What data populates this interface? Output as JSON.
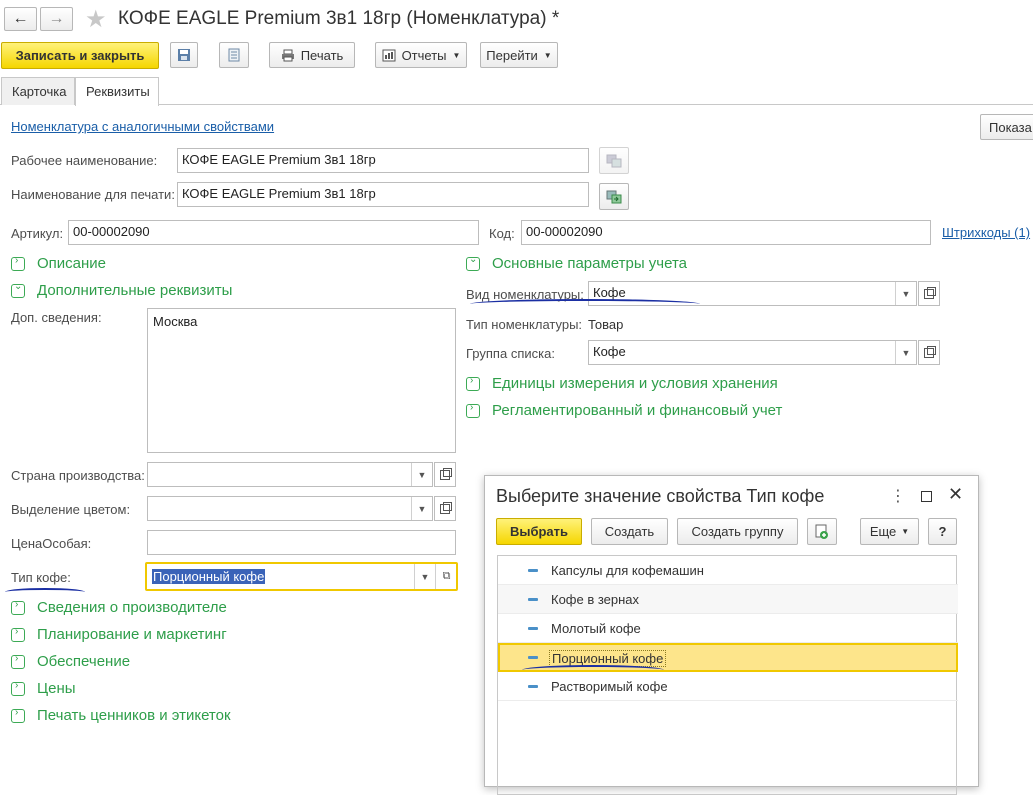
{
  "window": {
    "back_label": "←",
    "forward_label": "→",
    "title": "КОФЕ EAGLE Premium 3в1 18гр (Номенклатура) *"
  },
  "toolbar": {
    "save_close": "Записать и закрыть",
    "print": "Печать",
    "reports": "Отчеты",
    "goto": "Перейти"
  },
  "tabs": [
    "Карточка",
    "Реквизиты"
  ],
  "form": {
    "similar_link": "Номенклатура с аналогичными свойствами",
    "show_button": "Показа",
    "work_name_label": "Рабочее наименование:",
    "work_name_value": "КОФЕ EAGLE Premium 3в1 18гр",
    "print_name_label": "Наименование для печати:",
    "print_name_value": "КОФЕ EAGLE Premium 3в1 18гр",
    "article_label": "Артикул:",
    "article_value": "00-00002090",
    "code_label": "Код:",
    "code_value": "00-00002090",
    "barcodes_link": "Штрихкоды (1)",
    "dop_info_label": "Доп. сведения:",
    "dop_info_value": "Москва",
    "country_label": "Страна производства:",
    "color_label": "Выделение цветом:",
    "price_label": "ЦенаОсобая:",
    "coffee_type_label": "Тип кофе:",
    "coffee_type_value": "Порционный кофе"
  },
  "groups_left": {
    "description": "Описание",
    "additional": "Дополнительные реквизиты",
    "manufacturer": "Сведения о производителе",
    "planning": "Планирование и маркетинг",
    "supply": "Обеспечение",
    "prices": "Цены",
    "labels": "Печать ценников и этикеток"
  },
  "groups_right": {
    "main_params": "Основные параметры учета",
    "units": "Единицы измерения и условия хранения",
    "regulated": "Регламентированный и финансовый учет"
  },
  "accounting": {
    "kind_label": "Вид номенклатуры:",
    "kind_value": "Кофе",
    "type_label": "Тип номенклатуры:",
    "type_value": "Товар",
    "group_label": "Группа списка:",
    "group_value": "Кофе"
  },
  "dialog": {
    "title": "Выберите значение свойства Тип кофе",
    "select": "Выбрать",
    "create": "Создать",
    "create_group": "Создать группу",
    "more": "Еще",
    "help": "?",
    "items": [
      "Капсулы для кофемашин",
      "Кофе в зернах",
      "Молотый кофе",
      "Порционный кофе",
      "Растворимый кофе"
    ],
    "selected_index": 3
  },
  "colors": {
    "accent_yellow": "#f5d600",
    "group_green": "#2e9e4a",
    "link_blue": "#1a5ea8",
    "selection_yellow": "#fde58b",
    "pen_blue": "#1b2fa3"
  }
}
